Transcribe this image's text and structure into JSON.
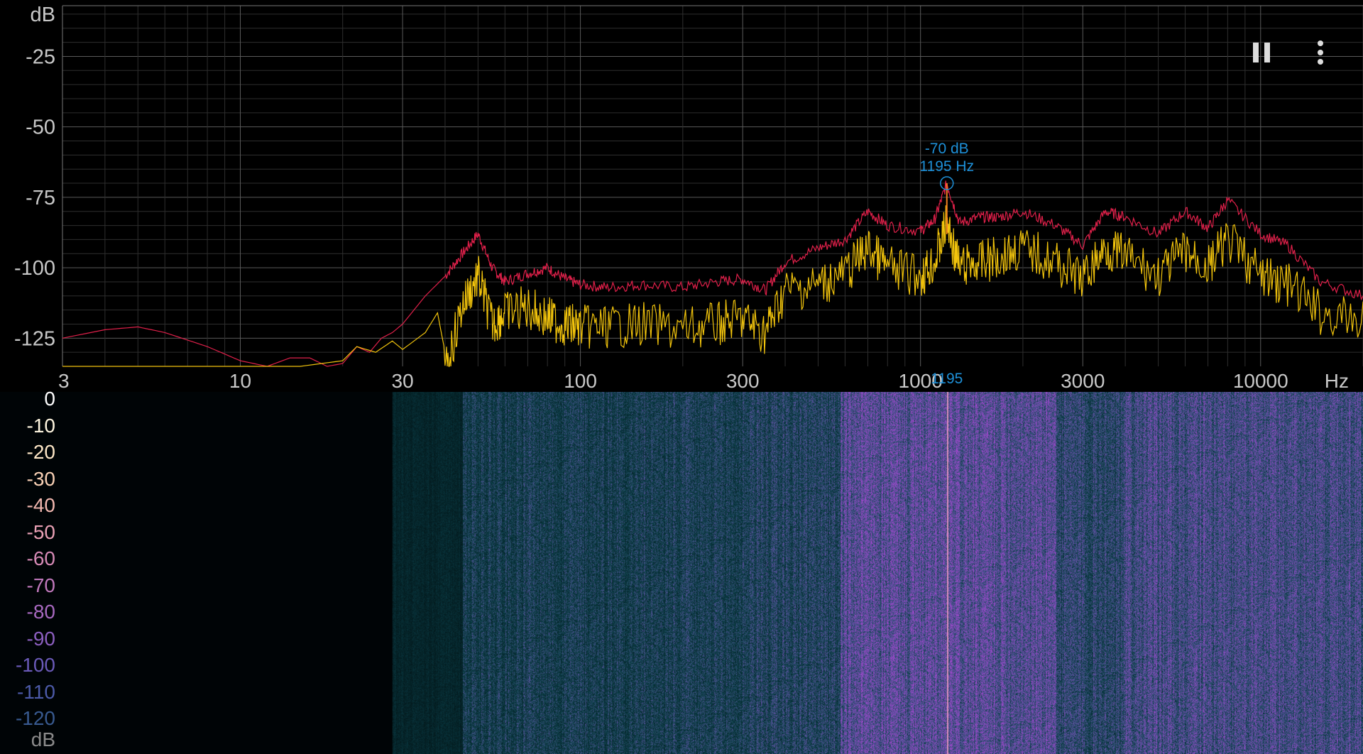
{
  "toolbar": {
    "pause_icon": "pause-icon",
    "menu_icon": "more-vert-icon"
  },
  "spectrum": {
    "y_unit": "dB",
    "x_unit": "Hz",
    "peak_db_label": "-70 dB",
    "peak_hz_label": "1195 Hz",
    "cursor_label": "1195"
  },
  "waterfall": {
    "scale_unit": "dB",
    "scale_ticks": [
      "0",
      "-10",
      "-20",
      "-30",
      "-40",
      "-50",
      "-60",
      "-70",
      "-80",
      "-90",
      "-100",
      "-110",
      "-120"
    ],
    "scale_colors": [
      "#ffffff",
      "#fff6e0",
      "#fde6c6",
      "#f8d0b4",
      "#f2b8b0",
      "#e8a0b4",
      "#d68ab6",
      "#c078bc",
      "#a869c0",
      "#8c5fc0",
      "#6a5ab8",
      "#4c5aa8",
      "#385a90"
    ]
  },
  "chart_data": {
    "type": "line",
    "x_scale": "log",
    "xlim": [
      3,
      20000
    ],
    "ylim": [
      -135,
      -7
    ],
    "y_ticks": [
      "dB",
      "-25",
      "-50",
      "-75",
      "-100",
      "-125"
    ],
    "x_ticks": [
      "3",
      "10",
      "30",
      "100",
      "300",
      "1000",
      "3000",
      "10000",
      "Hz"
    ],
    "grid": true,
    "series": [
      {
        "color": "#e0204a",
        "x": [
          3,
          4,
          5,
          6,
          8,
          10,
          12,
          14,
          16,
          18,
          20,
          22,
          24,
          26,
          28,
          30,
          35,
          40,
          45,
          50,
          55,
          60,
          70,
          80,
          90,
          100,
          120,
          150,
          200,
          250,
          300,
          350,
          400,
          500,
          600,
          700,
          800,
          1000,
          1100,
          1195,
          1300,
          1500,
          1700,
          2000,
          2500,
          3000,
          3500,
          4000,
          5000,
          6000,
          7000,
          8000,
          10000,
          12000,
          15000,
          20000
        ],
        "y": [
          -125,
          -122,
          -121,
          -123,
          -128,
          -133,
          -135,
          -132,
          -132,
          -135,
          -134,
          -128,
          -130,
          -125,
          -123,
          -120,
          -110,
          -103,
          -95,
          -88,
          -100,
          -105,
          -102,
          -100,
          -104,
          -106,
          -107,
          -106,
          -107,
          -105,
          -104,
          -108,
          -98,
          -93,
          -90,
          -80,
          -85,
          -87,
          -83,
          -70,
          -84,
          -82,
          -82,
          -80,
          -85,
          -92,
          -80,
          -82,
          -88,
          -80,
          -86,
          -76,
          -88,
          -92,
          -105,
          -110
        ]
      },
      {
        "color": "#f2c40c",
        "x": [
          3,
          5,
          8,
          10,
          15,
          20,
          22,
          25,
          28,
          30,
          35,
          38,
          40,
          45,
          50,
          55,
          60,
          70,
          80,
          90,
          100,
          120,
          150,
          200,
          250,
          300,
          350,
          400,
          500,
          600,
          700,
          800,
          1000,
          1100,
          1195,
          1300,
          1500,
          1700,
          2000,
          2500,
          3000,
          3500,
          4000,
          5000,
          6000,
          7000,
          8000,
          10000,
          12000,
          15000,
          20000
        ],
        "y": [
          -135,
          -135,
          -135,
          -135,
          -135,
          -133,
          -128,
          -130,
          -126,
          -129,
          -123,
          -116,
          -130,
          -105,
          -95,
          -112,
          -108,
          -106,
          -110,
          -112,
          -113,
          -113,
          -112,
          -114,
          -112,
          -110,
          -115,
          -100,
          -98,
          -94,
          -85,
          -92,
          -95,
          -90,
          -76,
          -92,
          -90,
          -88,
          -85,
          -90,
          -96,
          -85,
          -88,
          -95,
          -86,
          -92,
          -82,
          -95,
          -98,
          -108,
          -112
        ]
      }
    ],
    "peak": {
      "x": 1195,
      "y": -70
    }
  }
}
